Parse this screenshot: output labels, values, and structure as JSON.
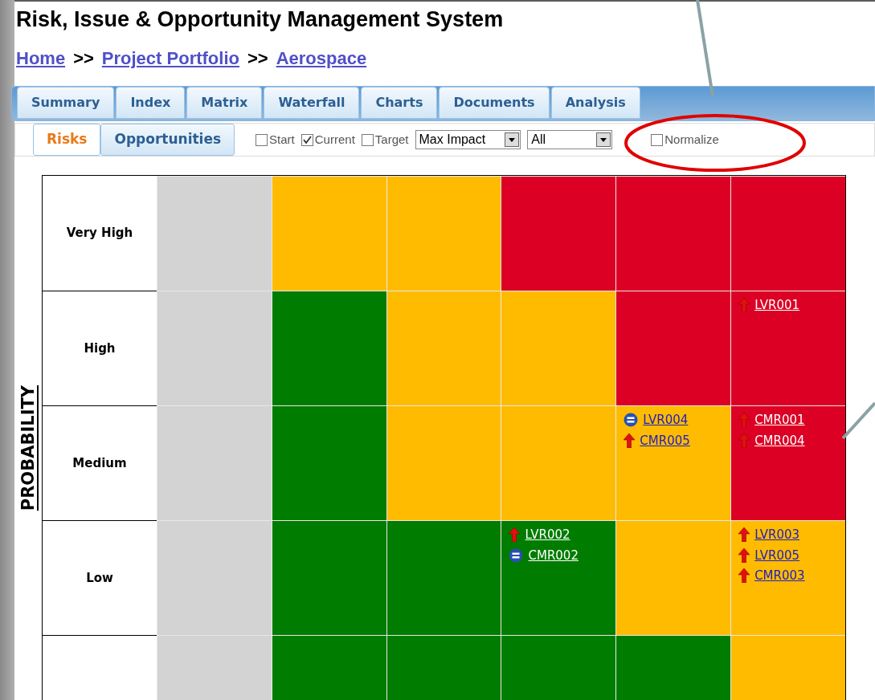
{
  "title": "Risk, Issue & Opportunity Management System",
  "breadcrumb": [
    {
      "label": "Home"
    },
    {
      "label": "Project Portfolio"
    },
    {
      "label": "Aerospace"
    }
  ],
  "breadcrumb_separator": ">>",
  "tabs": [
    {
      "label": "Summary",
      "selected": false
    },
    {
      "label": "Index",
      "selected": false
    },
    {
      "label": "Matrix",
      "selected": false
    },
    {
      "label": "Waterfall",
      "selected": false
    },
    {
      "label": "Charts",
      "selected": false
    },
    {
      "label": "Documents",
      "selected": false
    },
    {
      "label": "Analysis",
      "selected": false
    }
  ],
  "subtabs": [
    {
      "label": "Risks",
      "selected": true
    },
    {
      "label": "Opportunities",
      "selected": false
    }
  ],
  "filters": [
    {
      "kind": "checkbox",
      "label": "Start",
      "checked": false
    },
    {
      "kind": "checkbox",
      "label": "Current",
      "checked": true
    },
    {
      "kind": "checkbox",
      "label": "Target",
      "checked": false
    },
    {
      "kind": "select",
      "value": "Max Impact"
    },
    {
      "kind": "select",
      "value": "All"
    },
    {
      "kind": "checkbox",
      "label": "Normalize",
      "checked": false
    }
  ],
  "axis_label": "PROBABILITY",
  "matrix_rows": [
    {
      "label": "Very High",
      "cells": [
        {
          "color": "#d3d3d3"
        },
        {
          "color": "#ffbb00"
        },
        {
          "color": "#ffbb00"
        },
        {
          "color": "#dc0024"
        },
        {
          "color": "#dc0024"
        },
        {
          "color": "#dc0024"
        }
      ]
    },
    {
      "label": "High",
      "cells": [
        {
          "color": "#d3d3d3"
        },
        {
          "color": "#007c00"
        },
        {
          "color": "#ffbb00"
        },
        {
          "color": "#ffbb00"
        },
        {
          "color": "#dc0024"
        },
        {
          "color": "#dc0024",
          "items": [
            {
              "kind": "up",
              "id": "LVR001"
            }
          ]
        }
      ]
    },
    {
      "label": "Medium",
      "cells": [
        {
          "color": "#d3d3d3"
        },
        {
          "color": "#007c00"
        },
        {
          "color": "#ffbb00"
        },
        {
          "color": "#ffbb00"
        },
        {
          "color": "#ffbb00",
          "items": [
            {
              "kind": "steady",
              "id": "LVR004"
            },
            {
              "kind": "up",
              "id": "CMR005"
            }
          ]
        },
        {
          "color": "#dc0024",
          "items": [
            {
              "kind": "up",
              "id": "CMR001"
            },
            {
              "kind": "up",
              "id": "CMR004"
            }
          ]
        }
      ]
    },
    {
      "label": "Low",
      "cells": [
        {
          "color": "#d3d3d3"
        },
        {
          "color": "#007c00"
        },
        {
          "color": "#007c00"
        },
        {
          "color": "#007c00",
          "items": [
            {
              "kind": "up",
              "id": "LVR002"
            },
            {
              "kind": "steady",
              "id": "CMR002"
            }
          ]
        },
        {
          "color": "#ffbb00"
        },
        {
          "color": "#ffbb00",
          "items": [
            {
              "kind": "up",
              "id": "LVR003"
            },
            {
              "kind": "up",
              "id": "LVR005"
            },
            {
              "kind": "up",
              "id": "CMR003"
            }
          ]
        }
      ]
    },
    {
      "cells": [
        {
          "color": "#d3d3d3"
        },
        {
          "color": "#007c00"
        },
        {
          "color": "#007c00"
        },
        {
          "color": "#007c00"
        },
        {
          "color": "#007c00"
        },
        {
          "color": "#ffbb00"
        }
      ]
    }
  ]
}
